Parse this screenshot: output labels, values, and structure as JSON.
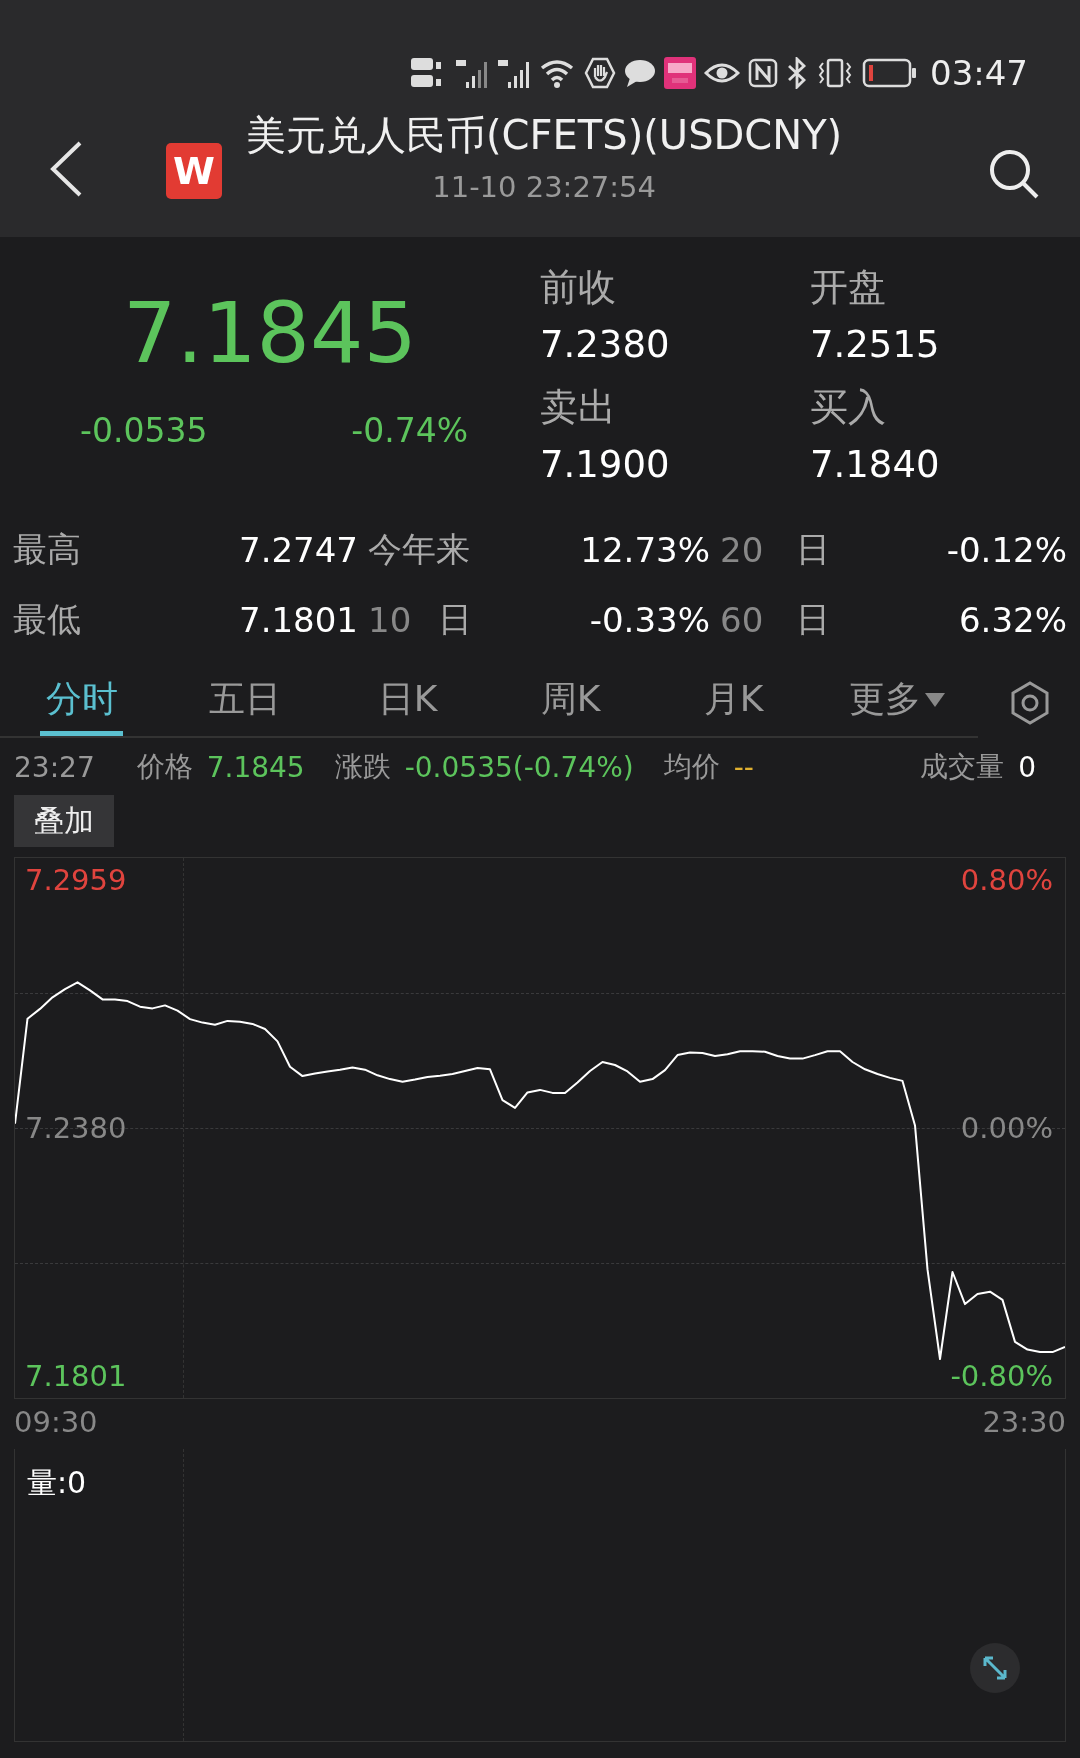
{
  "status_bar": {
    "time": "03:47"
  },
  "header": {
    "logo": "W",
    "title": "美元兑人民币(CFETS)(USDCNY)",
    "timestamp": "11-10 23:27:54"
  },
  "quote": {
    "price": "7.1845",
    "change": "-0.0535",
    "change_pct": "-0.74%",
    "fields": [
      {
        "label": "前收",
        "value": "7.2380"
      },
      {
        "label": "开盘",
        "value": "7.2515"
      },
      {
        "label": "卖出",
        "value": "7.1900"
      },
      {
        "label": "买入",
        "value": "7.1840"
      }
    ]
  },
  "stats": [
    [
      {
        "kind": "label",
        "text": "最高"
      },
      {
        "kind": "value",
        "text": "7.2747"
      },
      {
        "kind": "period",
        "text": "今年来"
      },
      {
        "kind": "pct",
        "text": "12.73%"
      },
      {
        "kind": "num",
        "text": "20"
      },
      {
        "kind": "unit",
        "text": "日"
      },
      {
        "kind": "pct",
        "text": "-0.12%"
      }
    ],
    [
      {
        "kind": "label",
        "text": "最低"
      },
      {
        "kind": "value",
        "text": "7.1801"
      },
      {
        "kind": "num",
        "text": "10"
      },
      {
        "kind": "unit",
        "text": "日"
      },
      {
        "kind": "pct",
        "text": "-0.33%"
      },
      {
        "kind": "num",
        "text": "60"
      },
      {
        "kind": "unit",
        "text": "日"
      },
      {
        "kind": "pct",
        "text": "6.32%"
      }
    ]
  ],
  "tabs": [
    {
      "label": "分时",
      "selected": true,
      "kind": "tab"
    },
    {
      "label": "五日",
      "selected": false,
      "kind": "tab"
    },
    {
      "label": "日K",
      "selected": false,
      "kind": "tab"
    },
    {
      "label": "周K",
      "selected": false,
      "kind": "tab"
    },
    {
      "label": "月K",
      "selected": false,
      "kind": "tab"
    },
    {
      "label": "更多",
      "selected": false,
      "kind": "menu"
    }
  ],
  "info_bar": {
    "time": "23:27",
    "items": [
      {
        "label": "价格",
        "value": "7.1845",
        "color": "#5cc45c"
      },
      {
        "label": "涨跌",
        "value": "-0.0535(-0.74%)",
        "color": "#5cc45c"
      },
      {
        "label": "均价",
        "value": "--",
        "color": "#e0b030"
      },
      {
        "label": "成交量",
        "value": "0",
        "color": "#ffffff"
      }
    ]
  },
  "overlay_button": "叠加",
  "chart": {
    "right_labels": [
      "0.80%",
      "0.00%",
      "-0.80%"
    ],
    "time_labels": [
      "09:30",
      "23:30"
    ],
    "chart_data": {
      "type": "line",
      "ylim": [
        7.175,
        7.301
      ],
      "yticks": [
        {
          "value": 7.2959,
          "label": "7.2959"
        },
        {
          "value": 7.238,
          "label": "7.2380"
        },
        {
          "value": 7.1801,
          "label": "7.1801"
        }
      ],
      "categories": [
        null,
        null,
        null,
        null,
        null,
        null,
        null,
        null,
        null,
        null,
        null,
        null,
        null,
        null,
        null,
        null,
        null,
        null,
        null,
        null,
        null,
        null,
        null,
        null,
        null,
        null,
        null,
        null,
        null,
        null,
        null,
        null,
        null,
        null,
        null,
        null,
        null,
        null,
        null,
        null,
        null,
        null,
        null,
        null,
        null,
        null,
        null,
        null,
        null,
        null,
        null,
        null,
        null,
        null,
        null,
        null,
        null,
        null,
        null,
        null,
        null,
        null,
        null,
        null,
        null,
        null,
        null,
        null,
        null,
        null,
        null,
        null,
        null,
        null,
        null,
        null,
        null,
        null,
        null,
        null,
        null,
        null,
        null,
        null,
        null
      ],
      "series": [
        {
          "color": "#ffffff",
          "values": [
            7.239,
            7.2635,
            7.2658,
            7.2685,
            7.2704,
            7.272,
            7.2701,
            7.268,
            7.268,
            7.2676,
            7.2663,
            7.2659,
            7.2666,
            7.2654,
            7.2634,
            7.2626,
            7.2621,
            7.263,
            7.2628,
            7.2623,
            7.2611,
            7.2582,
            7.2523,
            7.2501,
            7.2507,
            7.2512,
            7.2516,
            7.2521,
            7.2516,
            7.2503,
            7.2494,
            7.2488,
            7.2493,
            7.2499,
            7.2502,
            7.2506,
            7.2513,
            7.252,
            7.2517,
            7.2445,
            7.2427,
            7.2463,
            7.2469,
            7.2462,
            7.2462,
            7.2486,
            7.2513,
            7.2534,
            7.2527,
            7.2512,
            7.2488,
            7.2494,
            7.2515,
            7.255,
            7.2556,
            7.2555,
            7.2548,
            7.2552,
            7.2559,
            7.2559,
            7.2558,
            7.2548,
            7.2542,
            7.2542,
            7.255,
            7.2559,
            7.2559,
            7.2534,
            7.2517,
            7.2506,
            7.2497,
            7.249,
            7.2386,
            7.205,
            7.1841,
            7.2044,
            7.1969,
            7.1993,
            7.1998,
            7.1979,
            7.1881,
            7.1863,
            7.1857,
            7.1857,
            7.1869
          ]
        }
      ]
    }
  },
  "volume": {
    "label": "量:0"
  }
}
